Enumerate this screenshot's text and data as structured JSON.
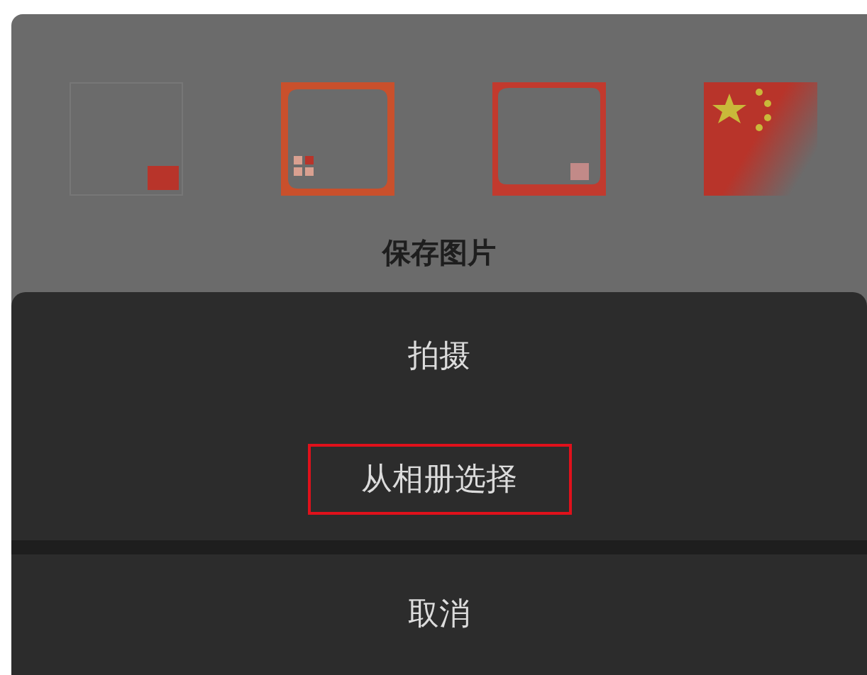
{
  "frames": [
    {
      "kind": "corner-flag"
    },
    {
      "kind": "orange-frame"
    },
    {
      "kind": "red-frame"
    },
    {
      "kind": "flag"
    }
  ],
  "title": "保存图片",
  "sheet": {
    "items": [
      {
        "label": "拍摄",
        "highlighted": false
      },
      {
        "label": "从相册选择",
        "highlighted": true
      }
    ],
    "cancel": "取消"
  }
}
